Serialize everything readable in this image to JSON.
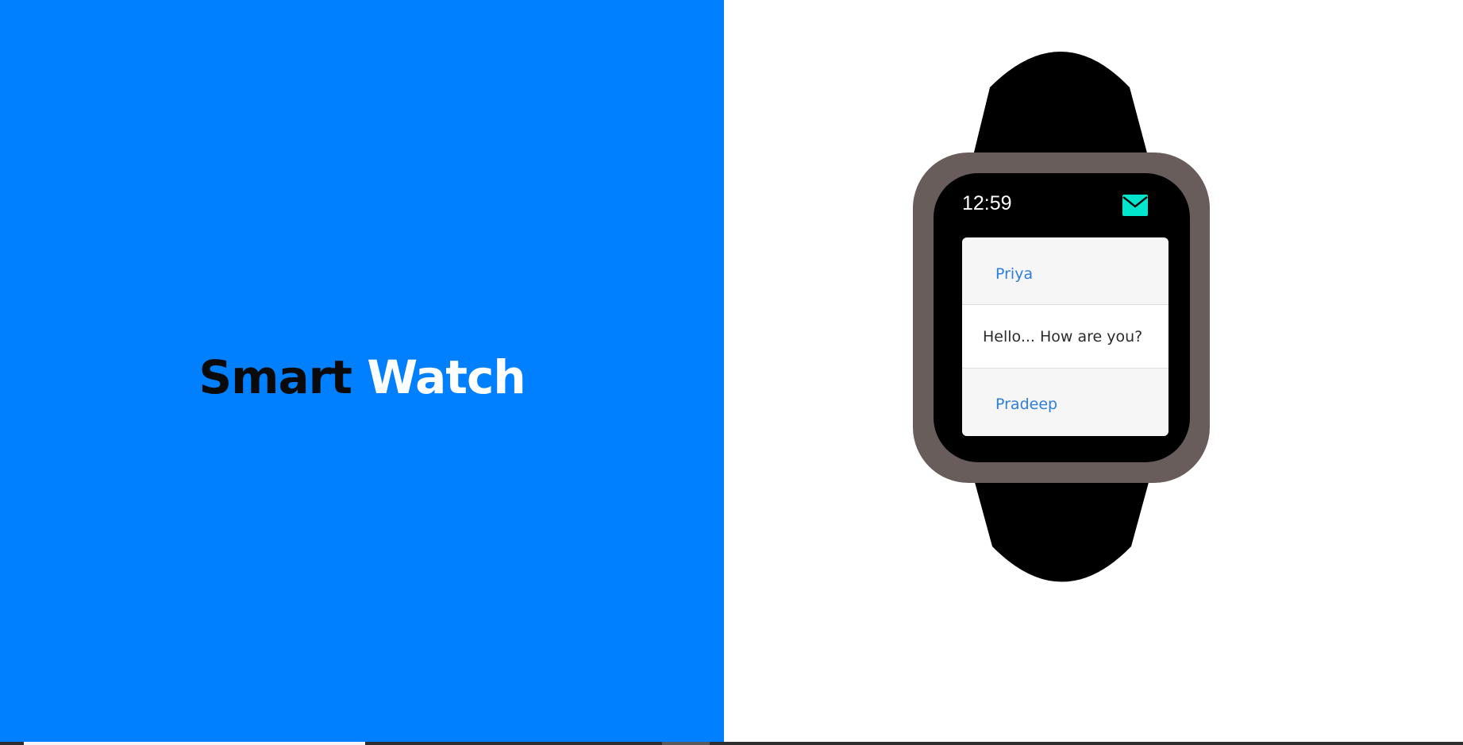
{
  "hero": {
    "title_word_1": "Smart",
    "title_word_2": "Watch"
  },
  "watch": {
    "time": "12:59",
    "notification_icon": "mail-icon",
    "messages": {
      "sender_1": "Priya",
      "message_text": "Hello... How are you?",
      "sender_2": "Pradeep"
    }
  },
  "colors": {
    "left_panel_bg": "#0080ff",
    "title_dark": "#0a0a0a",
    "title_light": "#ffffff",
    "watch_bezel": "#695d5b",
    "watch_strap": "#000000",
    "mail_icon": "#00e5cc",
    "sender_link": "#2d7ee0"
  }
}
